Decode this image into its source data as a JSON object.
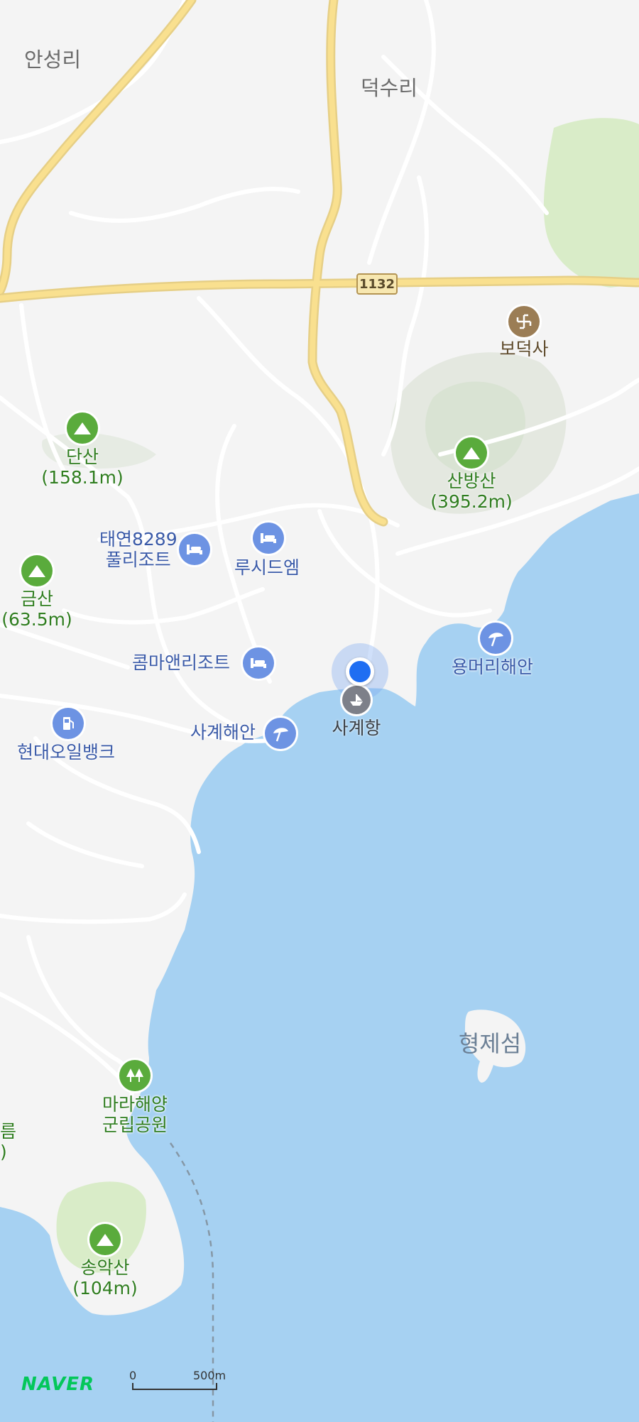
{
  "map": {
    "places": {
      "anseongri": "안성리",
      "deoksuri": "덕수리",
      "hyeongjeseom": "형제섬"
    },
    "route_shield": "1132",
    "pois": {
      "bodeoksa": "보덕사",
      "dansan_name": "단산",
      "dansan_height": "(158.1m)",
      "sanbangsan_name": "산방산",
      "sanbangsan_height": "(395.2m)",
      "taeyeon_line1": "태연8289",
      "taeyeon_line2": "풀리조트",
      "lucid": "루시드엠",
      "geumsan_name": "금산",
      "geumsan_height": "(63.5m)",
      "yongmeori": "용머리해안",
      "komma": "콤마앤리조트",
      "sagyehang": "사계항",
      "sagye_beach": "사계해안",
      "hyundai_oil": "현대오일뱅크",
      "mara_line1": "마라해양",
      "mara_line2": "군립공원",
      "songaksan_name": "송악산",
      "songaksan_height": "(104m)",
      "edge_partial_1": "름",
      "edge_partial_2": ")"
    },
    "logo": "NAVER",
    "scale_zero": "0",
    "scale_distance": "500m"
  },
  "colors": {
    "land": "#f4f4f4",
    "sea": "#a6d1f2",
    "park": "#d9ecc8",
    "road_major": "#f9e08f",
    "accent_green": "#5aab3c",
    "accent_blue": "#6d93e3",
    "location": "#1f6ef2"
  },
  "icons": {
    "mountain": "mountain-icon",
    "hotel": "bed-icon",
    "beach": "beach-umbrella-icon",
    "temple": "temple-icon",
    "gas": "fuel-pump-icon",
    "park": "trees-icon",
    "harbor": "harbor-icon"
  }
}
